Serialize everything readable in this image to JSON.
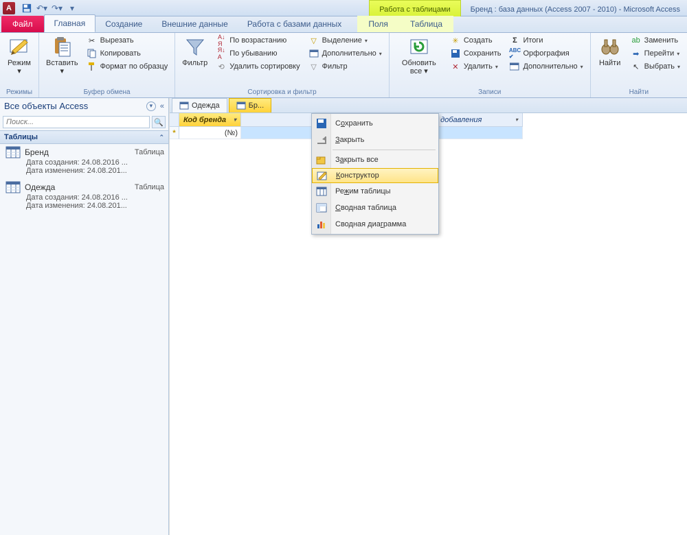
{
  "title": "Бренд : база данных (Access 2007 - 2010)  -  Microsoft Access",
  "contextual_group": "Работа с таблицами",
  "tabs": {
    "file": "Файл",
    "home": "Главная",
    "create": "Создание",
    "external": "Внешние данные",
    "dbtools": "Работа с базами данных",
    "ctx_fields": "Поля",
    "ctx_table": "Таблица"
  },
  "ribbon": {
    "views": {
      "mode": "Режим",
      "group": "Режимы"
    },
    "clipboard": {
      "paste": "Вставить",
      "cut": "Вырезать",
      "copy": "Копировать",
      "painter": "Формат по образцу",
      "group": "Буфер обмена"
    },
    "sort": {
      "filter": "Фильтр",
      "asc": "По возрастанию",
      "desc": "По убыванию",
      "remove": "Удалить сортировку",
      "selection": "Выделение",
      "advanced": "Дополнительно",
      "toggle": "Фильтр",
      "group": "Сортировка и фильтр"
    },
    "records": {
      "refresh": "Обновить все",
      "new": "Создать",
      "save": "Сохранить",
      "delete": "Удалить",
      "totals": "Итоги",
      "spelling": "Орфография",
      "more": "Дополнительно",
      "group": "Записи"
    },
    "find": {
      "find": "Найти",
      "replace": "Заменить",
      "goto": "Перейти",
      "select": "Выбрать",
      "group": "Найти"
    }
  },
  "nav": {
    "title": "Все объекты Access",
    "search_placeholder": "Поиск...",
    "tables_header": "Таблицы",
    "items": [
      {
        "name": "Бренд",
        "type": "Таблица",
        "created": "Дата создания: 24.08.2016 ...",
        "modified": "Дата изменения: 24.08.201..."
      },
      {
        "name": "Одежда",
        "type": "Таблица",
        "created": "Дата создания: 24.08.2016 ...",
        "modified": "Дата изменения: 24.08.201..."
      }
    ]
  },
  "doc_tabs": [
    "Одежда",
    "Бр..."
  ],
  "sheet": {
    "col_key": "Код бренда",
    "col_add": "Щелкните для добавления",
    "new_row_value": "(№)"
  },
  "context_menu": {
    "save": "Сохранить",
    "close": "Закрыть",
    "close_all": "Закрыть все",
    "design": "Конструктор",
    "datasheet": "Режим таблицы",
    "pivot_table": "Сводная таблица",
    "pivot_chart": "Сводная диаграмма"
  }
}
